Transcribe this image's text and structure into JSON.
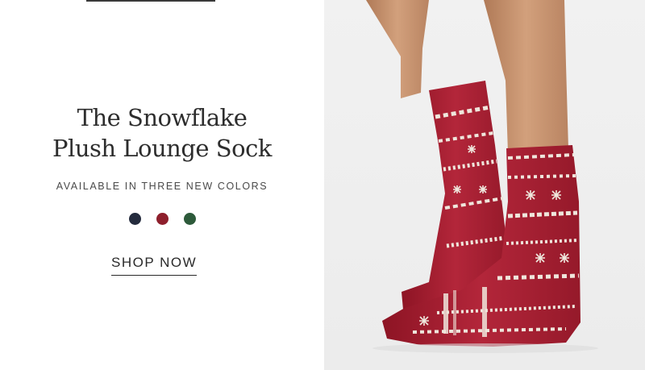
{
  "hero": {
    "title_line1": "The Snowflake",
    "title_line2": "Plush Lounge Sock",
    "subtitle": "AVAILABLE IN THREE NEW COLORS",
    "cta_label": "SHOP NOW"
  },
  "swatches": [
    {
      "name": "navy",
      "color": "#242b3d"
    },
    {
      "name": "red",
      "color": "#8e1f2c"
    },
    {
      "name": "green",
      "color": "#2d5a3a"
    }
  ],
  "image": {
    "alt": "Legs wearing red snowflake plush lounge socks"
  }
}
